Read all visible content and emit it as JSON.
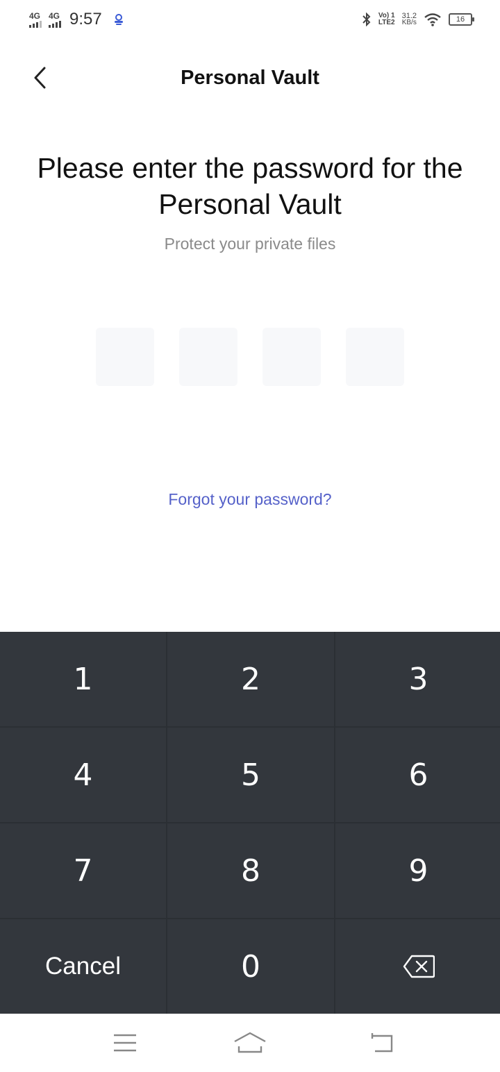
{
  "status_bar": {
    "sim1_type": "4G",
    "sim2_type": "4G",
    "time": "9:57",
    "volte_line1": "Vo) 1",
    "volte_line2": "LTE2",
    "speed_value": "31.2",
    "speed_unit": "KB/s",
    "battery": "16"
  },
  "header": {
    "title": "Personal Vault",
    "back_icon": "chevron-left-icon"
  },
  "main": {
    "prompt": "Please enter the password for the Personal Vault",
    "subtitle": "Protect your private files",
    "pin_length": 4,
    "forgot_link": "Forgot your password?"
  },
  "keypad": {
    "keys": [
      "1",
      "2",
      "3",
      "4",
      "5",
      "6",
      "7",
      "8",
      "9",
      "Cancel",
      "0"
    ],
    "delete_icon": "backspace-icon"
  },
  "nav_bar": {
    "icons": [
      "menu-icon",
      "home-icon",
      "back-icon"
    ]
  },
  "colors": {
    "link": "#5561c9",
    "keypad_bg": "#33373d",
    "keypad_divider": "#2b2f34",
    "pin_box": "#f7f8fa"
  }
}
